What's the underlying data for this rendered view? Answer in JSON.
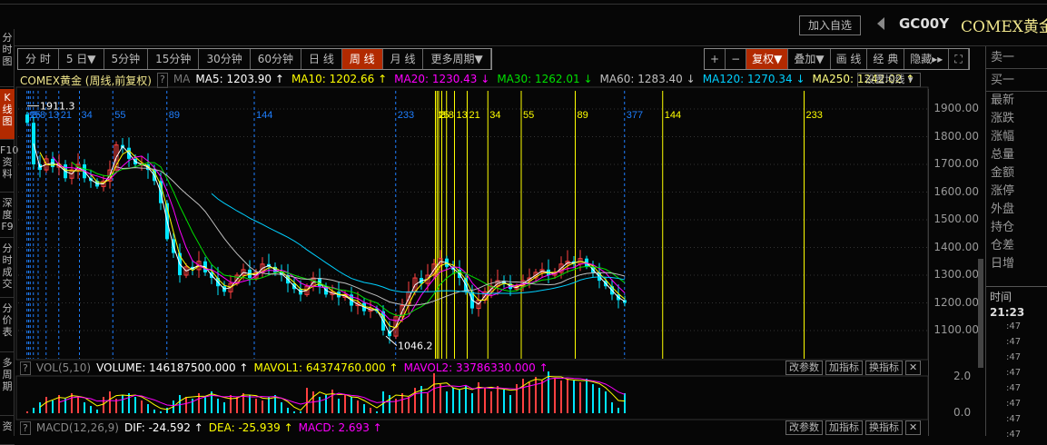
{
  "header": {
    "add_watchlist": "加入自选",
    "code": "GC00Y",
    "name": "COMEX黄金"
  },
  "sidebar": [
    {
      "label": "分时图"
    },
    {
      "label": "K线图",
      "active": true
    },
    {
      "label": "F10资料"
    },
    {
      "label": "深度F9"
    },
    {
      "label": "分时成交"
    },
    {
      "label": "分价表"
    },
    {
      "label": "多周期"
    },
    {
      "label": "资"
    }
  ],
  "periods": [
    {
      "label": "分 时"
    },
    {
      "label": "5 日▼"
    },
    {
      "label": "5分钟"
    },
    {
      "label": "15分钟"
    },
    {
      "label": "30分钟"
    },
    {
      "label": "60分钟"
    },
    {
      "label": "日 线"
    },
    {
      "label": "周 线",
      "active": true
    },
    {
      "label": "月 线"
    },
    {
      "label": "更多周期▼"
    }
  ],
  "tools": [
    {
      "label": "+"
    },
    {
      "label": "−"
    },
    {
      "label": "复权▼",
      "active": true
    },
    {
      "label": "叠加▼"
    },
    {
      "label": "画 线"
    },
    {
      "label": "经 典"
    },
    {
      "label": "隐藏▸▸"
    },
    {
      "label": "⛶"
    }
  ],
  "info": {
    "title": "COMEX黄金 (周线,前复权)",
    "q": "?",
    "ma": "MA",
    "items": [
      {
        "text": "MA5: 1203.90 ↑",
        "color": "#ffffff"
      },
      {
        "text": "MA10: 1202.66 ↑",
        "color": "#ffff00"
      },
      {
        "text": "MA20: 1230.43 ↓",
        "color": "#ff00ff"
      },
      {
        "text": "MA30: 1262.01 ↓",
        "color": "#00e000"
      },
      {
        "text": "MA60: 1283.40 ↓",
        "color": "#c0c0c0"
      },
      {
        "text": "MA120: 1270.34 ↓",
        "color": "#00d0ff"
      },
      {
        "text": "MA250: 1242.02 ↑",
        "color": "#ffff80"
      }
    ],
    "set_ma": "设置均线 ▾"
  },
  "right_panel": {
    "quote_labels": [
      "卖一",
      "买一",
      "最新",
      "涨跌",
      "涨幅",
      "总量",
      "金额",
      "涨停",
      "外盘",
      "持仓",
      "仓差",
      "日增"
    ],
    "time_label": "时间",
    "time": "21:23",
    "ticks": [
      ":47",
      ":47",
      ":47",
      ":47",
      ":47",
      ":47",
      ":47",
      ":47"
    ]
  },
  "vol": {
    "q": "?",
    "label": "VOL(5,10)",
    "volume": "VOLUME: 146187500.000 ↑",
    "mavol1": "MAVOL1: 64374760.000 ↑",
    "mavol2": "MAVOL2: 33786330.000 ↑",
    "btn1": "改参数",
    "btn2": "加指标",
    "btn3": "换指标",
    "close": "✕",
    "ticks": [
      "2.0",
      "0.0"
    ]
  },
  "macd": {
    "q": "?",
    "label": "MACD(12,26,9)",
    "dif": "DIF: -24.592 ↑",
    "dea": "DEA: -25.939 ↑",
    "macd": "MACD: 2.693 ↑",
    "btn1": "改参数",
    "btn2": "加指标",
    "btn3": "换指标",
    "close": "✕"
  },
  "chart_data": {
    "type": "candlestick",
    "title": "COMEX黄金 周线",
    "ylim": [
      1050,
      1950
    ],
    "yticks": [
      "1900.00",
      "1800.00",
      "1700.00",
      "1600.00",
      "1500.00",
      "1400.00",
      "1300.00",
      "1200.00",
      "1100.00"
    ],
    "weeks_per_sample": 4,
    "total_weeks": 376,
    "high_label": "1911.3",
    "low_label": "1046.2",
    "closes": [
      1850,
      1700,
      1680,
      1720,
      1690,
      1700,
      1650,
      1680,
      1700,
      1650,
      1640,
      1620,
      1640,
      1680,
      1770,
      1760,
      1720,
      1700,
      1700,
      1680,
      1640,
      1560,
      1430,
      1380,
      1300,
      1330,
      1320,
      1350,
      1310,
      1290,
      1260,
      1240,
      1270,
      1300,
      1320,
      1290,
      1310,
      1340,
      1330,
      1310,
      1300,
      1270,
      1250,
      1230,
      1260,
      1290,
      1260,
      1230,
      1240,
      1220,
      1230,
      1190,
      1200,
      1170,
      1180,
      1170,
      1100,
      1080,
      1150,
      1190,
      1240,
      1290,
      1270,
      1300,
      1340,
      1360,
      1330,
      1320,
      1290,
      1240,
      1180,
      1210,
      1240,
      1260,
      1280,
      1270,
      1250,
      1260,
      1280,
      1290,
      1310,
      1320,
      1300,
      1310,
      1340,
      1350,
      1340,
      1360,
      1330,
      1310,
      1280,
      1260,
      1230,
      1210,
      1200
    ],
    "volume": [
      0.1,
      0.3,
      0.6,
      0.9,
      0.7,
      1.0,
      0.8,
      1.1,
      0.9,
      0.6,
      0.4,
      0.2,
      0.9,
      1.2,
      0.8,
      1.0,
      1.1,
      0.9,
      0.7,
      0.5,
      0.2,
      0.1,
      0.3,
      0.7,
      1.0,
      0.9,
      0.8,
      1.1,
      0.9,
      1.2,
      0.8,
      0.6,
      1.0,
      0.9,
      1.1,
      1.0,
      0.8,
      0.7,
      0.9,
      1.0,
      0.6,
      0.3,
      0.1,
      0.1,
      1.4,
      1.2,
      0.9,
      1.0,
      1.3,
      0.8,
      1.0,
      0.9,
      0.7,
      0.5,
      0.3,
      0.1,
      1.2,
      1.0,
      0.8,
      1.1,
      0.9,
      1.4,
      1.5,
      1.1,
      2.2,
      1.6,
      1.2,
      1.4,
      1.3,
      1.5,
      1.1,
      1.7,
      1.4,
      1.2,
      1.5,
      1.3,
      1.0,
      1.6,
      1.9,
      1.7,
      2.0,
      1.8,
      2.3,
      1.9,
      1.8,
      1.9,
      1.8,
      1.7,
      1.9,
      1.6,
      1.4,
      1.2,
      0.6,
      0.3,
      1.1
    ],
    "fib_blue": {
      "start_week": 0,
      "labels": [
        1,
        2,
        3,
        5,
        8,
        13,
        21,
        34,
        55,
        89,
        144,
        233,
        377
      ]
    },
    "fib_yellow": {
      "start_week": 257,
      "labels": [
        1,
        2,
        3,
        5,
        8,
        13,
        21,
        34,
        55,
        89,
        144,
        233
      ]
    },
    "ma_colors": [
      "#ffffff",
      "#ffff00",
      "#ff00ff",
      "#00e000",
      "#c0c0c0",
      "#00d0ff"
    ],
    "up_color": "#ff4040",
    "down_color": "#00e5ff"
  }
}
